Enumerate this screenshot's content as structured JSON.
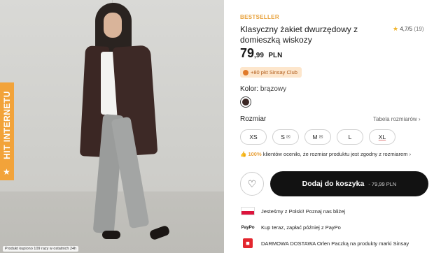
{
  "photo": {
    "badge_text": "HIT INTERNETU",
    "caption": "Produkt kupiono 109 razy w ostatnich 24h"
  },
  "product": {
    "bestseller": "BESTSELLER",
    "title": "Klasyczny żakiet dwurzędowy z domieszką wiskozy",
    "rating": {
      "value": "4,7/5",
      "count": "(19)"
    },
    "price": {
      "integer": "79",
      "decimal": ",99",
      "currency": "PLN"
    },
    "club_points": "+80 pkt Sinsay Club",
    "color": {
      "label": "Kolor:",
      "value": "brązowy",
      "swatch_hex": "#3b2724"
    },
    "size": {
      "label": "Rozmiar",
      "table_link": "Tabela rozmiarów",
      "options": [
        "XS",
        "S",
        "M",
        "L",
        "XL"
      ]
    },
    "fit": {
      "percent": "100%",
      "text": "klientów oceniło, że rozmiar produktu jest zgodny z rozmiarem"
    },
    "cart": {
      "label": "Dodaj do koszyka",
      "price": "- 79,99 PLN"
    },
    "info": [
      "Jesteśmy z Polski! Poznaj nas bliżej",
      "Kup teraz, zapłać później z PayPo",
      "DARMOWA DOSTAWA Orlen Paczką na produkty marki Sinsay"
    ],
    "paypo_logo": "PayPo"
  },
  "colors": {
    "accent": "#e8a23c",
    "button": "#121212",
    "club_bg": "#fde6cc"
  }
}
